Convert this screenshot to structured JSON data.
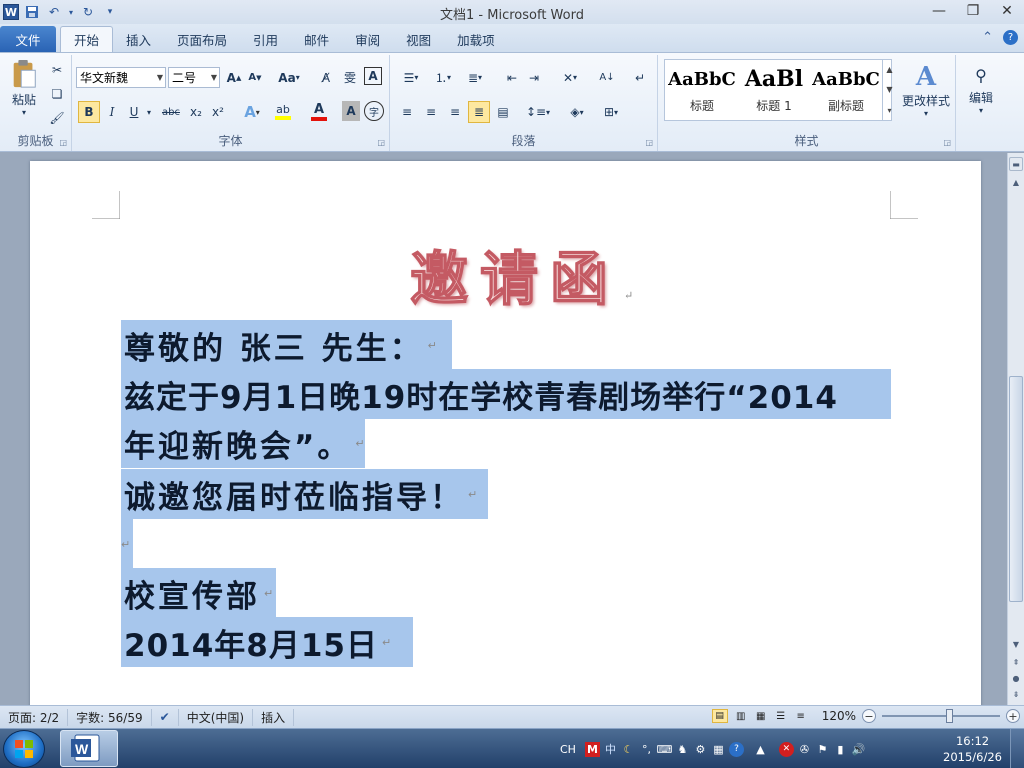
{
  "app": {
    "title": "文档1 - Microsoft Word",
    "quick_access": {
      "save_icon": "save-icon",
      "undo_icon": "undo-icon",
      "redo_icon": "redo-icon",
      "customize_icon": "customize-qat-icon"
    }
  },
  "tabs": {
    "file": "文件",
    "items": [
      "开始",
      "插入",
      "页面布局",
      "引用",
      "邮件",
      "审阅",
      "视图",
      "加载项"
    ],
    "active": "开始"
  },
  "ribbon": {
    "clipboard": {
      "label": "剪贴板",
      "paste": "粘贴"
    },
    "font": {
      "label": "字体",
      "font_name": "华文新魏",
      "font_size": "二号",
      "grow": "A",
      "shrink": "A",
      "change_case": "Aa",
      "bold": "B",
      "italic": "I",
      "underline": "U",
      "strike": "abc",
      "sub": "x₂",
      "sup": "x²",
      "font_color_accent": "#e3120b",
      "highlight_accent": "#ffff00"
    },
    "paragraph": {
      "label": "段落"
    },
    "styles": {
      "label": "样式",
      "items": [
        {
          "sample": "AaBbC",
          "name": "标题"
        },
        {
          "sample": "AaBl",
          "name": "标题 1"
        },
        {
          "sample": "AaBbC",
          "name": "副标题"
        }
      ],
      "change_styles": "更改样式"
    },
    "editing": {
      "label": "编辑"
    }
  },
  "document": {
    "title": "邀请函",
    "lines": [
      "尊敬的 张三 先生：",
      "兹定于9月1日晚19时在学校青春剧场举行“2014",
      "年迎新晚会”。",
      "诚邀您届时莅临指导！",
      "",
      "校宣传部",
      "2014年8月15日"
    ],
    "paragraph_mark": "↵"
  },
  "status": {
    "page": "页面: 2/2",
    "words": "字数: 56/59",
    "language": "中文(中国)",
    "mode": "插入",
    "zoom_label": "120%",
    "zoom_minus": "−",
    "zoom_plus": "+",
    "zoom_fraction": 0.58
  },
  "taskbar": {
    "tray_lang": "CH",
    "tray_ime": "中",
    "clock_time": "16:12",
    "clock_date": "2015/6/26"
  },
  "colors": {
    "selection": "#a7c6ec",
    "title_fill": "#f7dcdc",
    "title_stroke": "#c45a63"
  }
}
